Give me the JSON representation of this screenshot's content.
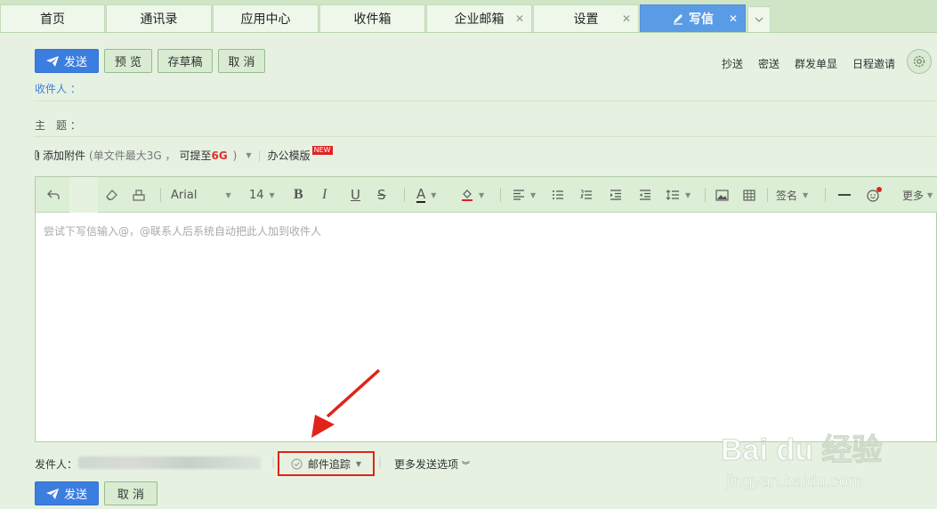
{
  "tabs": [
    {
      "label": "首页",
      "closable": false
    },
    {
      "label": "通讯录",
      "closable": false
    },
    {
      "label": "应用中心",
      "closable": false
    },
    {
      "label": "收件箱",
      "closable": false
    },
    {
      "label": "企业邮箱",
      "closable": true
    },
    {
      "label": "设置",
      "closable": true
    },
    {
      "label": "写信",
      "closable": true,
      "active": true
    }
  ],
  "toolbar": {
    "send_label": "发送",
    "preview_label": "预 览",
    "draft_label": "存草稿",
    "cancel_label": "取 消",
    "cc_label": "抄送",
    "bcc_label": "密送",
    "separate_label": "群发单显",
    "schedule_label": "日程邀请"
  },
  "fields": {
    "recipient_label": "收件人 ：",
    "subject_label": "主　题 ："
  },
  "attachment": {
    "add_label": "添加附件",
    "limit_prefix": "(单文件最大3G ，",
    "limit_mid": "可提至",
    "limit_big": "6G",
    "limit_suffix": ")",
    "template_label": "办公模版",
    "new_badge": "NEW"
  },
  "editor": {
    "font_family": "Arial",
    "font_size": "14",
    "signature_label": "签名",
    "more_label": "更多",
    "placeholder": "尝试下写信输入@，@联系人后系统自动把此人加到收件人"
  },
  "footer": {
    "sender_label": "发件人：",
    "tracking_label": "邮件追踪",
    "more_options_label": "更多发送选项",
    "send_label": "发送",
    "cancel_label": "取 消"
  },
  "watermark": {
    "brand": "Bai du 经验",
    "url": "jingyan.baidu.com"
  },
  "colors": {
    "accent": "#3b7ee0",
    "active_tab": "#5a9be6",
    "background": "#e6f1e1",
    "highlight_box": "#e0231b",
    "label_blue": "#3b7ee0"
  }
}
